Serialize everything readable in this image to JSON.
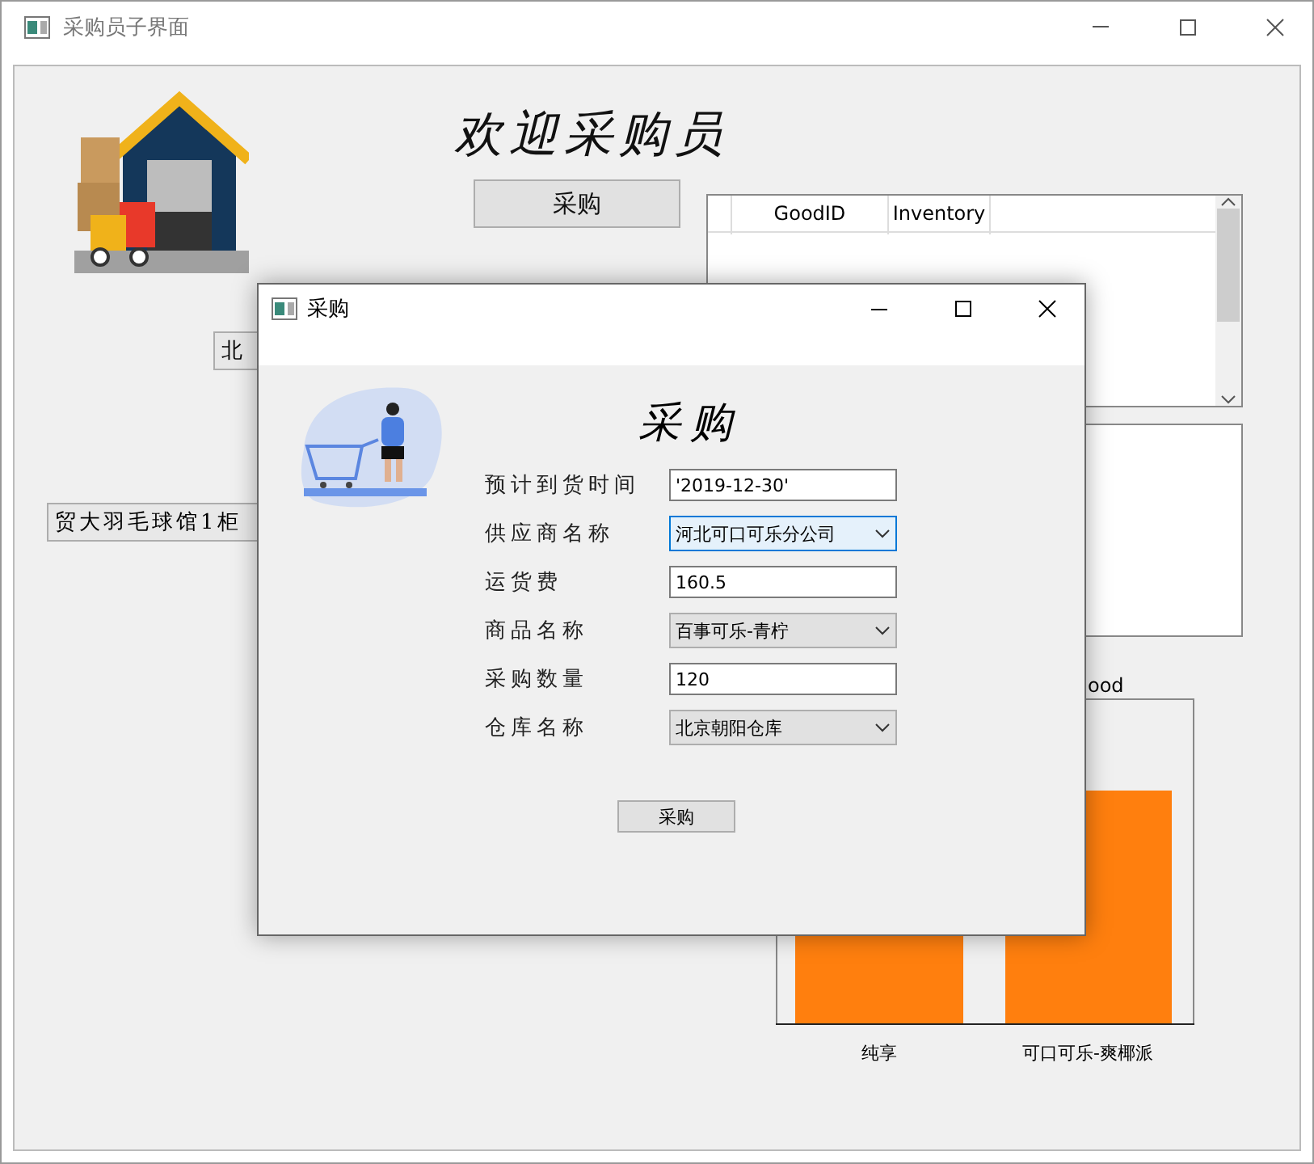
{
  "window": {
    "title": "采购员子界面"
  },
  "main": {
    "heading": "欢迎采购员",
    "purchase_button": "采购",
    "label_1": "北",
    "label_2": "贸大羽毛球馆1柜",
    "table": {
      "columns": [
        "GoodID",
        "Inventory"
      ]
    },
    "chart": {
      "title": "ood",
      "categories": [
        "纯享",
        "可口可乐-爽椰派"
      ]
    }
  },
  "dialog": {
    "title": "采购",
    "heading": "采购",
    "fields": [
      {
        "label": "预计到货时间",
        "kind": "text",
        "value": "'2019-12-30'",
        "focused": false
      },
      {
        "label": "供应商名称",
        "kind": "combo",
        "value": "河北可口可乐分公司",
        "focused": true
      },
      {
        "label": "运货费",
        "kind": "text",
        "value": "160.5",
        "focused": false
      },
      {
        "label": "商品名称",
        "kind": "combo",
        "value": "百事可乐-青柠",
        "focused": false
      },
      {
        "label": "采购数量",
        "kind": "text",
        "value": "120",
        "focused": false
      },
      {
        "label": "仓库名称",
        "kind": "combo",
        "value": "北京朝阳仓库",
        "focused": false
      }
    ],
    "submit": "采购"
  }
}
